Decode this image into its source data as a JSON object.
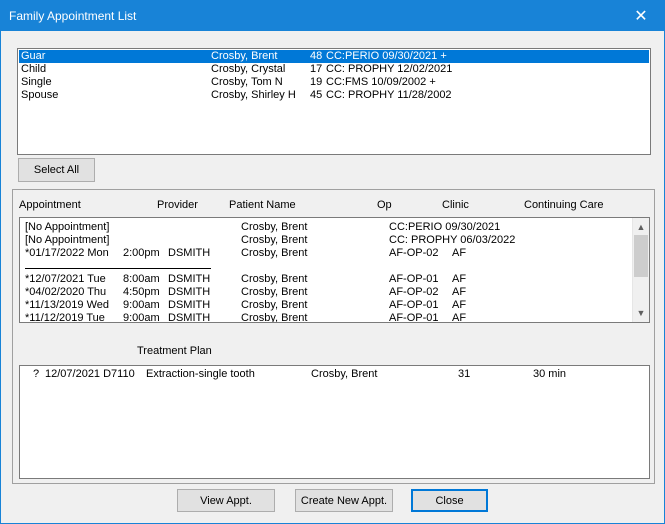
{
  "window": {
    "title": "Family Appointment List",
    "close_glyph": "✕"
  },
  "family": {
    "rows": [
      {
        "role": "Guar",
        "name": "Crosby, Brent",
        "age": "48",
        "cc": "CC:PERIO 09/30/2021 +",
        "selected": true
      },
      {
        "role": "Child",
        "name": "Crosby, Crystal",
        "age": "17",
        "cc": "CC: PROPHY 12/02/2021",
        "selected": false
      },
      {
        "role": "Single",
        "name": "Crosby, Tom N",
        "age": "19",
        "cc": "CC:FMS 10/09/2002 +",
        "selected": false
      },
      {
        "role": "Spouse",
        "name": "Crosby, Shirley H",
        "age": "45",
        "cc": "CC: PROPHY 11/28/2002",
        "selected": false
      }
    ]
  },
  "select_all_label": "Select All",
  "appointments": {
    "headers": {
      "appointment": "Appointment",
      "provider": "Provider",
      "patient": "Patient Name",
      "op": "Op",
      "clinic": "Clinic",
      "cc": "Continuing Care"
    },
    "rows": [
      {
        "date": "[No Appointment]",
        "time": "",
        "provider": "",
        "patient": "Crosby, Brent",
        "op": "CC:PERIO 09/30/2021",
        "clinic": ""
      },
      {
        "date": "[No Appointment]",
        "time": "",
        "provider": "",
        "patient": "Crosby, Brent",
        "op": "CC: PROPHY 06/03/2022",
        "clinic": ""
      },
      {
        "date": "*01/17/2022 Mon",
        "time": "2:00pm",
        "provider": "DSMITH",
        "patient": "Crosby, Brent",
        "op": "AF-OP-02",
        "clinic": "AF"
      },
      {
        "date": "*12/07/2021 Tue",
        "time": "8:00am",
        "provider": "DSMITH",
        "patient": "Crosby, Brent",
        "op": "AF-OP-01",
        "clinic": "AF"
      },
      {
        "date": "*04/02/2020 Thu",
        "time": "4:50pm",
        "provider": "DSMITH",
        "patient": "Crosby, Brent",
        "op": "AF-OP-02",
        "clinic": "AF"
      },
      {
        "date": "*11/13/2019 Wed",
        "time": "9:00am",
        "provider": "DSMITH",
        "patient": "Crosby, Brent",
        "op": "AF-OP-01",
        "clinic": "AF"
      },
      {
        "date": "*11/12/2019 Tue",
        "time": "9:00am",
        "provider": "DSMITH",
        "patient": "Crosby, Brent",
        "op": "AF-OP-01",
        "clinic": "AF"
      }
    ]
  },
  "treatment_plan": {
    "label": "Treatment Plan",
    "rows": [
      {
        "status": "?",
        "date_code": "12/07/2021 D7110",
        "description": "Extraction-single tooth",
        "patient": "Crosby, Brent",
        "tooth": "31",
        "duration": "30 min"
      }
    ]
  },
  "buttons": {
    "view": "View Appt.",
    "create": "Create New Appt.",
    "close": "Close"
  }
}
